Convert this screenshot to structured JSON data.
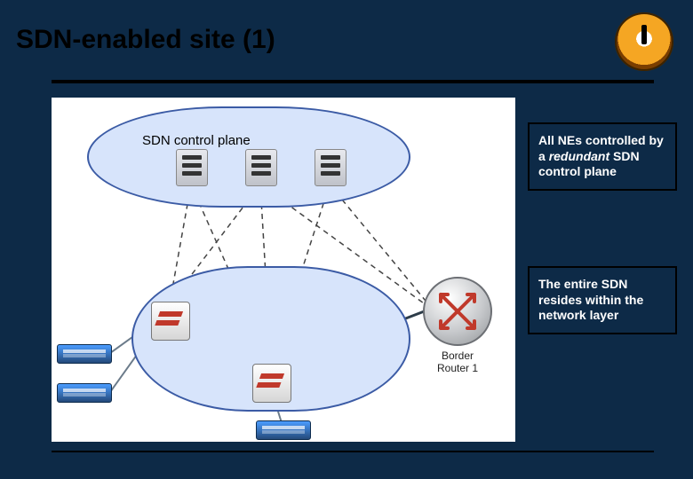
{
  "title": "SDN-enabled site (1)",
  "logo": {
    "alt": "Caltech seal"
  },
  "diagram": {
    "control_plane_label": "SDN control plane",
    "border_router_label": "Border\nRouter 1",
    "nodes": {
      "controllers": [
        "controller-1",
        "controller-2",
        "controller-3"
      ],
      "switches": [
        "switch-1",
        "switch-2"
      ],
      "servers": [
        "server-rack-1",
        "server-rack-2",
        "server-rack-3"
      ],
      "router": "border-router-1"
    }
  },
  "callouts": {
    "box1_line1": "All NEs controlled by a ",
    "box1_emph": "redundant",
    "box1_line2": " SDN control plane",
    "box2": "The entire SDN resides within the network layer"
  },
  "colors": {
    "background": "#0d2a47",
    "cloud_fill": "#d7e4fb",
    "cloud_stroke": "#3b5ba5",
    "accent_red": "#c0392b"
  }
}
